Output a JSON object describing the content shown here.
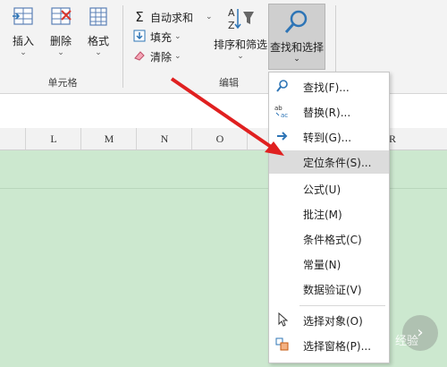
{
  "ribbon": {
    "cells_group": {
      "label": "单元格",
      "insert": "插入",
      "delete": "删除",
      "format": "格式"
    },
    "edit_group": {
      "label": "编辑",
      "autosum": "自动求和",
      "fill": "填充",
      "clear": "清除",
      "sort_filter": "排序和筛选",
      "find_select": "查找和选择"
    }
  },
  "columns": [
    "L",
    "M",
    "N",
    "O",
    "R"
  ],
  "menu": {
    "items": [
      {
        "label": "查找(F)...",
        "icon": "search-icon"
      },
      {
        "label": "替换(R)...",
        "icon": "replace-icon"
      },
      {
        "label": "转到(G)...",
        "icon": "goto-arrow-icon"
      },
      {
        "label": "定位条件(S)...",
        "icon": ""
      },
      {
        "label": "公式(U)",
        "icon": ""
      },
      {
        "label": "批注(M)",
        "icon": ""
      },
      {
        "label": "条件格式(C)",
        "icon": ""
      },
      {
        "label": "常量(N)",
        "icon": ""
      },
      {
        "label": "数据验证(V)",
        "icon": ""
      },
      {
        "label": "选择对象(O)",
        "icon": "pointer-icon"
      },
      {
        "label": "选择窗格(P)...",
        "icon": "selection-pane-icon"
      }
    ]
  },
  "colors": {
    "grid_bg": "#cce8cf",
    "arrow": "#e02020",
    "highlight": "#dcdcdc"
  },
  "watermark": {
    "text": "经验"
  }
}
